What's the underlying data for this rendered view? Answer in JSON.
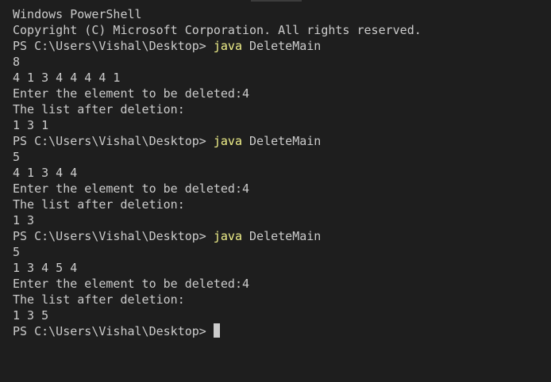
{
  "terminal": {
    "banner": [
      "Windows PowerShell",
      "Copyright (C) Microsoft Corporation. All rights reserved."
    ],
    "prompt": "PS C:\\Users\\Vishal\\Desktop> ",
    "sessions": [
      {
        "command": "java",
        "args": " DeleteMain",
        "output": [
          "8",
          "4 1 3 4 4 4 4 1",
          "Enter the element to be deleted:4",
          "The list after deletion:",
          "1 3 1"
        ]
      },
      {
        "command": "java",
        "args": " DeleteMain",
        "output": [
          "5",
          "4 1 3 4 4",
          "Enter the element to be deleted:4",
          "The list after deletion:",
          "1 3"
        ]
      },
      {
        "command": "java",
        "args": " DeleteMain",
        "output": [
          "5",
          "1 3 4 5 4",
          "Enter the element to be deleted:4",
          "The list after deletion:",
          "1 3 5"
        ]
      }
    ]
  },
  "colors": {
    "background": "#1e1e1e",
    "text": "#cccccc",
    "command": "#f0f08a"
  }
}
